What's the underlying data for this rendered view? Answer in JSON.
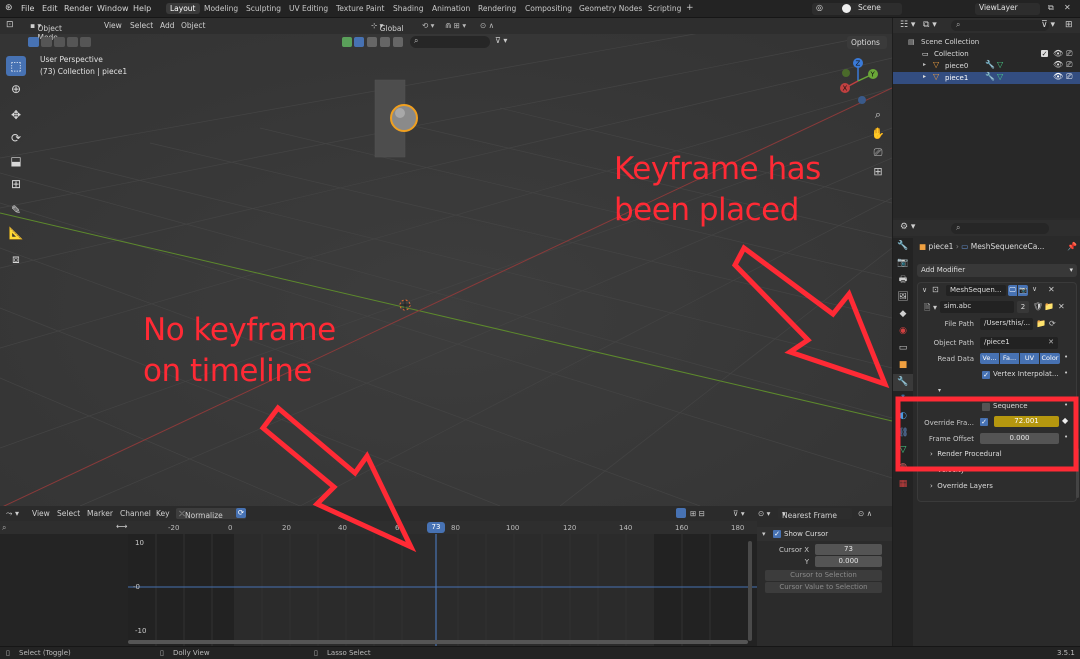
{
  "menubar": {
    "items": [
      "File",
      "Edit",
      "Render",
      "Window",
      "Help"
    ],
    "workspaces": [
      "Layout",
      "Modeling",
      "Sculpting",
      "UV Editing",
      "Texture Paint",
      "Shading",
      "Animation",
      "Rendering",
      "Compositing",
      "Geometry Nodes",
      "Scripting"
    ],
    "active_workspace": "Layout",
    "add_tab": "+",
    "scene": "Scene",
    "view_layer": "ViewLayer"
  },
  "viewport": {
    "mode": "Object Mode",
    "menus": [
      "View",
      "Select",
      "Add",
      "Object"
    ],
    "transform_orientation": "Global",
    "options": "Options",
    "overlay_title": "User Perspective",
    "overlay_subtitle": "(73) Collection | piece1",
    "gizmo_labels": [
      "Z",
      "Y",
      "X"
    ]
  },
  "annotations": {
    "right_line1": "Keyframe has",
    "right_line2": "been placed",
    "left_line1": "No keyframe",
    "left_line2": "on timeline",
    "color": "#ff2a35"
  },
  "timeline": {
    "menus": [
      "View",
      "Select",
      "Marker",
      "Channel",
      "Key"
    ],
    "normalize": "Normalize",
    "interp": "Nearest Frame",
    "ruler_ticks": [
      "-20",
      "0",
      "20",
      "40",
      "60",
      "73",
      "80",
      "100",
      "120",
      "140",
      "160",
      "180"
    ],
    "current_frame": "73",
    "y_labels": [
      "10",
      "0",
      "-10"
    ],
    "panel": {
      "show_cursor": "Show Cursor",
      "cursor_x_label": "Cursor X",
      "cursor_x": "73",
      "y_label": "Y",
      "y_value": "0.000",
      "cursor_to_selection": "Cursor to Selection",
      "cursor_value_to_selection": "Cursor Value to Selection"
    }
  },
  "statusbar": {
    "left": "Select (Toggle)",
    "middle": "Dolly View",
    "right": "Lasso Select",
    "version": "3.5.1"
  },
  "outliner": {
    "scene_collection": "Scene Collection",
    "collection": "Collection",
    "items": [
      "piece0",
      "piece1"
    ]
  },
  "properties": {
    "object_name": "piece1",
    "modifier_breadcrumb": "MeshSequenceCa...",
    "add_modifier": "Add Modifier",
    "modifier_name": "MeshSequen...",
    "cache_file": "sim.abc",
    "cache_users": "2",
    "file_path_label": "File Path",
    "file_path": "/Users/this/...",
    "object_path_label": "Object Path",
    "object_path": "/piece1",
    "read_data_label": "Read Data",
    "read_data": [
      "Ve...",
      "Fa...",
      "UV",
      "Color"
    ],
    "vertex_interp": "Vertex Interpolat...",
    "sequence": "Sequence",
    "override_frame_label": "Override Fra...",
    "override_frame": "72.001",
    "frame_offset_label": "Frame Offset",
    "frame_offset": "0.000",
    "render_procedural": "Render Procedural",
    "velocity": "Velocity",
    "override_layers": "Override Layers"
  }
}
